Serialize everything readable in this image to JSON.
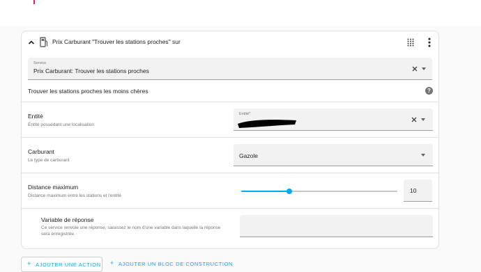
{
  "action_card": {
    "title": "Prix Carburant \"Trouver les stations proches\" sur",
    "service_field": {
      "label": "Service",
      "value": "Prix Carburant: Trouver les stations proches"
    },
    "service_description": "Trouver les stations proches les moins chères",
    "help_glyph": "?",
    "fields": {
      "entity": {
        "title": "Entité",
        "subtitle": "Entité possédant une localisation",
        "input_label": "Entité*",
        "value_redacted": true
      },
      "fuel": {
        "title": "Carburant",
        "subtitle": "Le type de carburant",
        "value": "Gazole"
      },
      "distance": {
        "title": "Distance maximum",
        "subtitle": "Distance maximum entre les stations et l'entité",
        "value": "10",
        "slider_fraction": 0.31
      },
      "response": {
        "title": "Variable de réponse",
        "subtitle_line1": "Ce service renvoie une réponse, saisissez le nom d'une variable dans laquelle la réponse",
        "subtitle_line2": "sera enregistrée.",
        "value": ""
      }
    }
  },
  "footer": {
    "add_action": "AJOUTER UNE ACTION",
    "add_block": "AJOUTER UN BLOC DE CONSTRUCTION"
  },
  "icons": {
    "collapse": "chevron-up-icon",
    "service": "fuel-pump-icon",
    "drag": "drag-grid-icon",
    "menu": "kebab-menu-icon",
    "clear": "close-icon",
    "dropdown": "caret-down-icon",
    "help": "help-circle-icon",
    "add": "plus-icon"
  },
  "colors": {
    "accent": "#03a9f4",
    "field_bg": "#f2f2f2",
    "help_icon": "#757575",
    "top_mark": "#e91e63"
  }
}
